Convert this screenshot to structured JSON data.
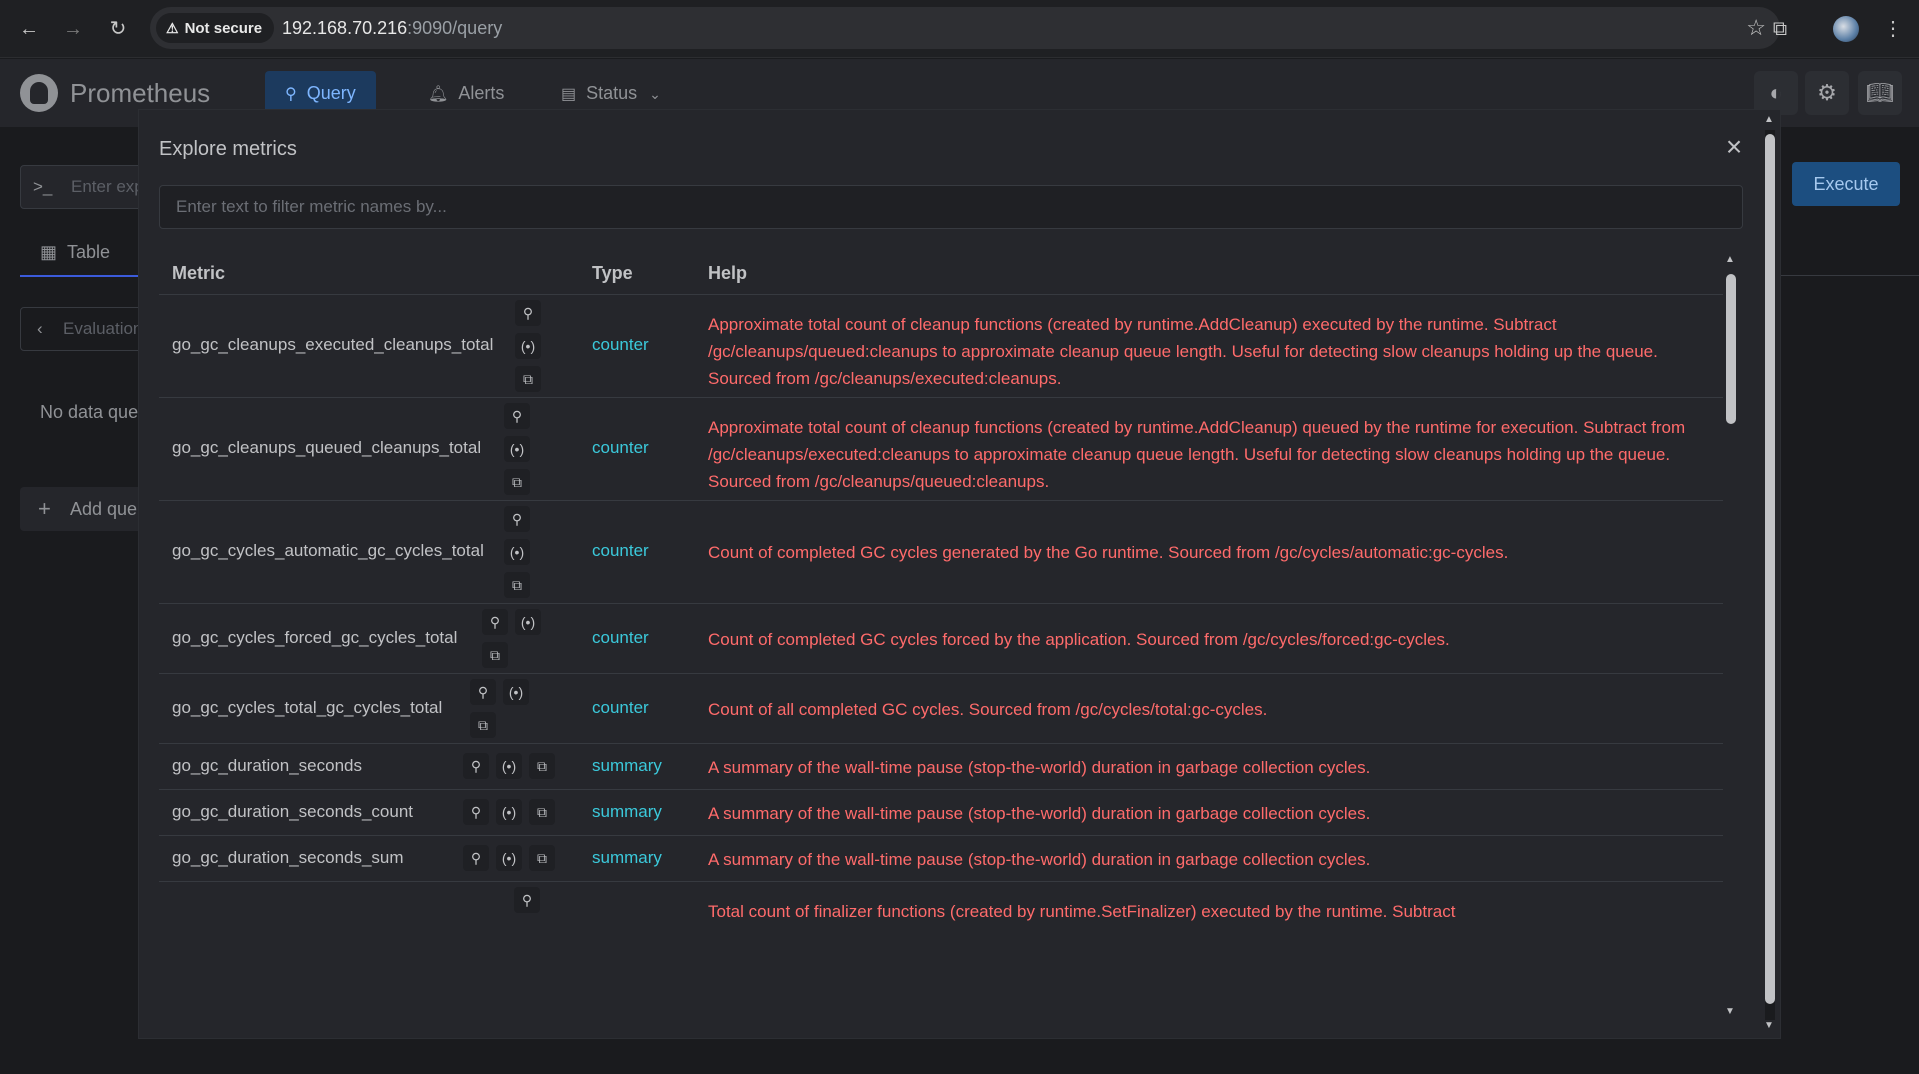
{
  "browser": {
    "security_label": "Not secure",
    "url_host": "192.168.70.216",
    "url_rest": ":9090/query"
  },
  "app": {
    "brand": "Prometheus",
    "nav": [
      {
        "label": "Query",
        "icon": "search-icon"
      },
      {
        "label": "Alerts",
        "icon": "bell-icon"
      },
      {
        "label": "Status",
        "icon": "server-icon"
      }
    ]
  },
  "background": {
    "expression_placeholder": "Enter exp",
    "execute_label": "Execute",
    "table_tab": "Table",
    "evaluation_label": "Evaluation",
    "no_data": "No data que",
    "add_query": "Add que"
  },
  "modal": {
    "title": "Explore metrics",
    "filter_placeholder": "Enter text to filter metric names by...",
    "columns": {
      "metric": "Metric",
      "type": "Type",
      "help": "Help"
    },
    "rows": [
      {
        "metric": "go_gc_cleanups_executed_cleanups_total",
        "type": "counter",
        "help": "Approximate total count of cleanup functions (created by runtime.AddCleanup) executed by the runtime. Subtract /gc/cleanups/queued:cleanups to approximate cleanup queue length. Useful for detecting slow cleanups holding up the queue. Sourced from /gc/cleanups/executed:cleanups."
      },
      {
        "metric": "go_gc_cleanups_queued_cleanups_total",
        "type": "counter",
        "help": "Approximate total count of cleanup functions (created by runtime.AddCleanup) queued by the runtime for execution. Subtract from /gc/cleanups/executed:cleanups to approximate cleanup queue length. Useful for detecting slow cleanups holding up the queue. Sourced from /gc/cleanups/queued:cleanups."
      },
      {
        "metric": "go_gc_cycles_automatic_gc_cycles_total",
        "type": "counter",
        "help": "Count of completed GC cycles generated by the Go runtime. Sourced from /gc/cycles/automatic:gc-cycles."
      },
      {
        "metric": "go_gc_cycles_forced_gc_cycles_total",
        "type": "counter",
        "help": "Count of completed GC cycles forced by the application. Sourced from /gc/cycles/forced:gc-cycles."
      },
      {
        "metric": "go_gc_cycles_total_gc_cycles_total",
        "type": "counter",
        "help": "Count of all completed GC cycles. Sourced from /gc/cycles/total:gc-cycles."
      },
      {
        "metric": "go_gc_duration_seconds",
        "type": "summary",
        "help": "A summary of the wall-time pause (stop-the-world) duration in garbage collection cycles."
      },
      {
        "metric": "go_gc_duration_seconds_count",
        "type": "summary",
        "help": "A summary of the wall-time pause (stop-the-world) duration in garbage collection cycles."
      },
      {
        "metric": "go_gc_duration_seconds_sum",
        "type": "summary",
        "help": "A summary of the wall-time pause (stop-the-world) duration in garbage collection cycles."
      },
      {
        "metric": "",
        "type": "",
        "help": "Total count of finalizer functions (created by runtime.SetFinalizer) executed by the runtime. Subtract"
      }
    ]
  },
  "colors": {
    "type_text": "#3bc9db",
    "help_text": "#ff6b6b",
    "active_tab_bg": "#1c3a5e"
  }
}
